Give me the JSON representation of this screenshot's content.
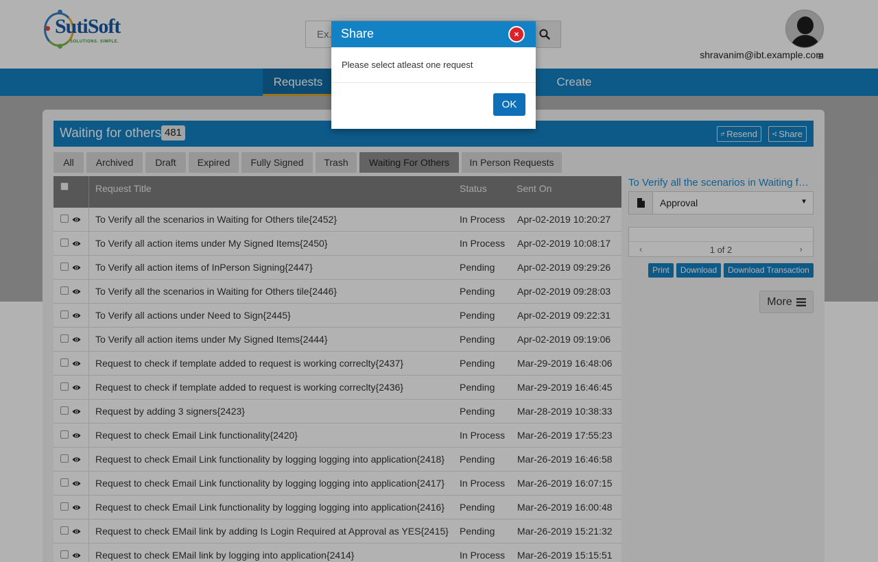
{
  "header": {
    "logo_text": "SutiSoft",
    "logo_tagline": "SOLUTIONS. SIMPLE.",
    "search_placeholder": "Ex.",
    "user_email": "shravanim@ibt.example.com",
    "user_menu_icon": "≡"
  },
  "nav": {
    "requests": "Requests",
    "create": "Create"
  },
  "panel": {
    "title": "Waiting for others",
    "count": "481",
    "resend_label": "Resend",
    "share_label": "Share"
  },
  "tabs": [
    "All",
    "Archived",
    "Draft",
    "Expired",
    "Fully Signed",
    "Trash",
    "Waiting For Others",
    "In Person Requests"
  ],
  "active_tab": "Waiting For Others",
  "table": {
    "headers": {
      "title": "Request Title",
      "status": "Status",
      "sent": "Sent On"
    },
    "rows": [
      {
        "title": "To Verify all the scenarios in Waiting for Others tile{2452}",
        "status": "In Process",
        "sent": "Apr-02-2019 10:20:27"
      },
      {
        "title": "To Verify all action items under My Signed Items{2450}",
        "status": "In Process",
        "sent": "Apr-02-2019 10:08:17"
      },
      {
        "title": "To Verify all action items of InPerson Signing{2447}",
        "status": "Pending",
        "sent": "Apr-02-2019 09:29:26"
      },
      {
        "title": "To Verify all the scenarios in Waiting for Others tile{2446}",
        "status": "Pending",
        "sent": "Apr-02-2019 09:28:03"
      },
      {
        "title": "To Verify all actions under Need to Sign{2445}",
        "status": "Pending",
        "sent": "Apr-02-2019 09:22:31"
      },
      {
        "title": "To Verify all action items under My Signed Items{2444}",
        "status": "Pending",
        "sent": "Apr-02-2019 09:19:06"
      },
      {
        "title": "Request to check if template added to request is working correclty{2437}",
        "status": "Pending",
        "sent": "Mar-29-2019 16:48:06"
      },
      {
        "title": "Request to check if template added to request is working correclty{2436}",
        "status": "Pending",
        "sent": "Mar-29-2019 16:46:45"
      },
      {
        "title": "Request by adding 3 signers{2423}",
        "status": "Pending",
        "sent": "Mar-28-2019 10:38:33"
      },
      {
        "title": "Request to check Email Link functionality{2420}",
        "status": "In Process",
        "sent": "Mar-26-2019 17:55:23"
      },
      {
        "title": "Request to check Email Link functionality by logging logging into application{2418}",
        "status": "Pending",
        "sent": "Mar-26-2019 16:46:58"
      },
      {
        "title": "Request to check Email Link functionality by logging logging into application{2417}",
        "status": "In Process",
        "sent": "Mar-26-2019 16:07:15"
      },
      {
        "title": "Request to check Email Link functionality by logging logging into application{2416}",
        "status": "Pending",
        "sent": "Mar-26-2019 16:00:48"
      },
      {
        "title": "Request to check EMail link by adding Is Login Required at Approval as YES{2415}",
        "status": "Pending",
        "sent": "Mar-26-2019 15:21:32"
      },
      {
        "title": "Request to check EMail link by logging into application{2414}",
        "status": "In Process",
        "sent": "Mar-26-2019 15:15:51"
      }
    ]
  },
  "preview": {
    "title": "To Verify all the scenarios in Waiting for Others tile",
    "document_select": "Approval",
    "pager_prev": "‹",
    "pager_next": "›",
    "pager_text": "1 of 2",
    "print_label": "Print",
    "download_label": "Download",
    "download_transaction_label": "Download Transaction",
    "more_label": "More"
  },
  "modal": {
    "title": "Share",
    "close_symbol": "×",
    "message": "Please select atleast one request",
    "ok_label": "OK"
  },
  "colors": {
    "primary_blue": "#1382c5",
    "accent_orange": "#e0a429",
    "close_red": "#d9222a"
  }
}
